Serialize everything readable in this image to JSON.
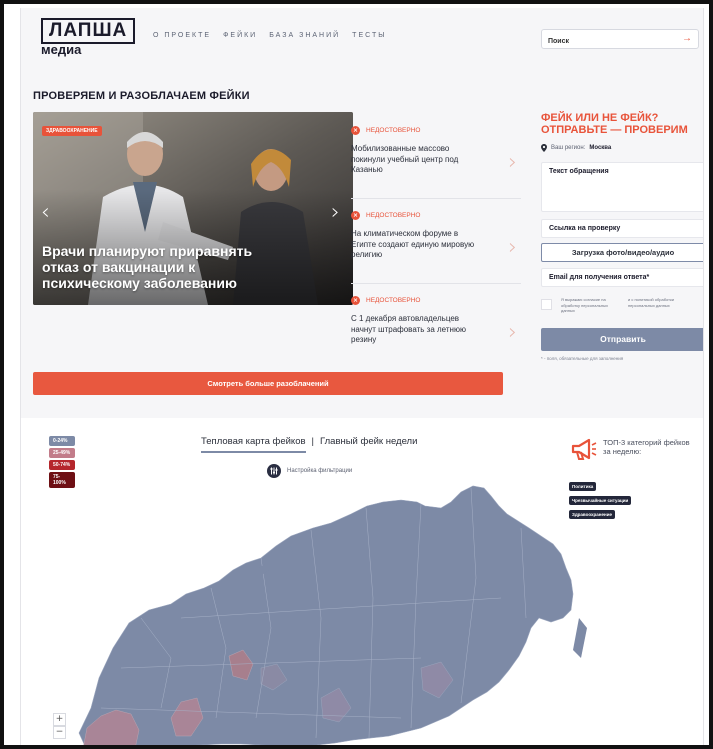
{
  "header": {
    "logo_main": "ЛАПША",
    "logo_sub": "медиа",
    "nav": [
      "О ПРОЕКТЕ",
      "ФЕЙКИ",
      "БАЗА ЗНАНИЙ",
      "ТЕСТЫ"
    ],
    "search_placeholder": "Поиск"
  },
  "section_title": "ПРОВЕРЯЕМ И РАЗОБЛАЧАЕМ ФЕЙКИ",
  "hero": {
    "tag": "здравоохранение",
    "title": "Врачи планируют приравнять отказ от вакцинации к психическому заболеванию"
  },
  "news": [
    {
      "status": "НЕДОСТОВЕРНО",
      "text": "Мобилизованные массово покинули учебный центр под Казанью"
    },
    {
      "status": "НЕДОСТОВЕРНО",
      "text": "На климатическом форуме в Египте создают единую мировую религию"
    },
    {
      "status": "НЕДОСТОВЕРНО",
      "text": "С 1 декабря автовладельцев начнут штрафовать за летнюю резину"
    }
  ],
  "form": {
    "title_line1": "ФЕЙК ИЛИ НЕ ФЕЙК?",
    "title_line2": "ОТПРАВЬТЕ — ПРОВЕРИМ",
    "region_label": "Ваш регион:",
    "region_value": "Москва",
    "message_placeholder": "Текст обращения",
    "link_placeholder": "Ссылка на проверку",
    "upload_label": "Загрузка фото/видео/аудио",
    "email_placeholder": "Email для получения ответа*",
    "consent_left": "Я выражаю согласие на обработку персональных данных",
    "consent_right": "и с политикой обработки персональных данных",
    "submit_label": "Отправить",
    "required_note": "* - поля, обязательные для заполнения"
  },
  "more_button": "Смотреть больше разоблачений",
  "map": {
    "legend": [
      {
        "label": "0-24%",
        "color": "#7d8aa6"
      },
      {
        "label": "25-49%",
        "color": "#c27c8a"
      },
      {
        "label": "50-74%",
        "color": "#b5262c"
      },
      {
        "label": "75-100%",
        "color": "#6e0f14"
      }
    ],
    "tab_active": "Тепловая карта фейков",
    "tab_separator": "|",
    "tab_other": "Главный фейк недели",
    "filter_label": "Настройка фильтрации",
    "top3_title": "ТОП-3 категорий фейков за неделю:",
    "top3_categories": [
      "Политика",
      "Чрезвычайные ситуации",
      "Здравоохранение"
    ],
    "zoom_in": "+",
    "zoom_out": "−"
  },
  "colors": {
    "accent": "#e8533a",
    "map_base": "#7d8aa6",
    "map_pink": "#a98597"
  }
}
